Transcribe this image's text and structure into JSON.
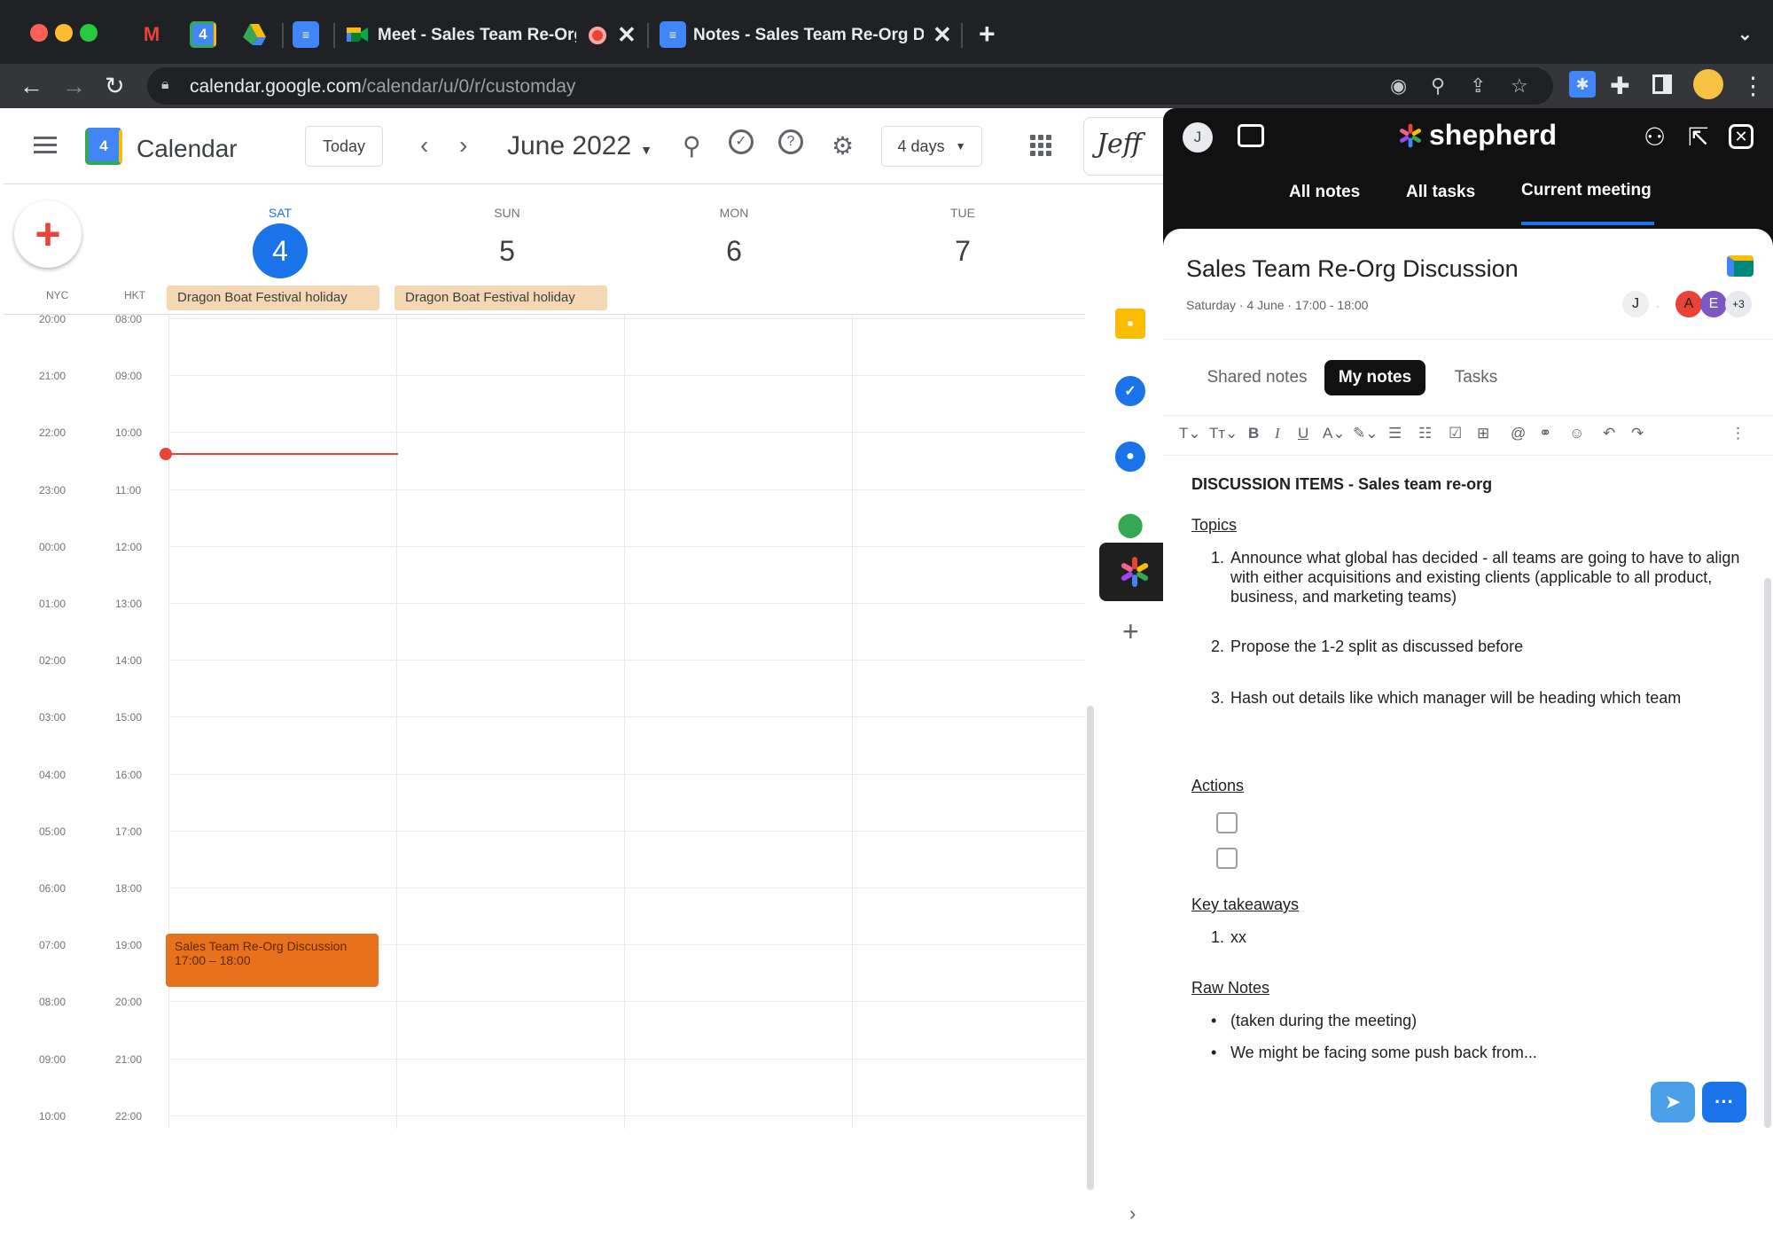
{
  "browser": {
    "colors": {
      "close": "#ff5f57",
      "minimize": "#febc2e",
      "maximize": "#28c840"
    },
    "tabs": [
      {
        "icon": "gmail-icon"
      },
      {
        "icon": "google-calendar-icon",
        "badge": "4"
      },
      {
        "icon": "google-drive-icon"
      },
      {
        "icon": "google-docs-icon"
      },
      {
        "icon": "google-meet-icon",
        "title": "Meet - Sales Team Re-Org"
      },
      {
        "icon": "google-docs-icon",
        "title": "Notes - Sales Team Re-Org Dis"
      }
    ],
    "close_glyph": "✕",
    "new_tab": "+",
    "url_domain": "calendar.google.com",
    "url_path": "/calendar/u/0/r/customday"
  },
  "calendar": {
    "logo_badge": "4",
    "app_name": "Calendar",
    "today_label": "Today",
    "month_label": "June 2022",
    "view_label": "4 days",
    "signature": "Jeff",
    "timezones": [
      "NYC",
      "HKT"
    ],
    "days": [
      {
        "dow": "SAT",
        "date": "4",
        "today": true
      },
      {
        "dow": "SUN",
        "date": "5"
      },
      {
        "dow": "MON",
        "date": "6"
      },
      {
        "dow": "TUE",
        "date": "7"
      }
    ],
    "allday_events": [
      "Dragon Boat Festival holiday",
      "Dragon Boat Festival holiday"
    ],
    "time_rows": [
      [
        "20:00",
        "08:00"
      ],
      [
        "21:00",
        "09:00"
      ],
      [
        "22:00",
        "10:00"
      ],
      [
        "23:00",
        "11:00"
      ],
      [
        "00:00",
        "12:00"
      ],
      [
        "01:00",
        "13:00"
      ],
      [
        "02:00",
        "14:00"
      ],
      [
        "03:00",
        "15:00"
      ],
      [
        "04:00",
        "16:00"
      ],
      [
        "05:00",
        "17:00"
      ],
      [
        "06:00",
        "18:00"
      ],
      [
        "07:00",
        "19:00"
      ],
      [
        "08:00",
        "20:00"
      ],
      [
        "09:00",
        "21:00"
      ],
      [
        "10:00",
        "22:00"
      ]
    ],
    "event": {
      "title": "Sales Team Re-Org Discussion",
      "time": "17:00 – 18:00",
      "color": "#e8711c"
    }
  },
  "shepherd": {
    "avatar": "J",
    "brand": "shepherd",
    "tabs": [
      "All notes",
      "All tasks",
      "Current meeting"
    ],
    "active_tab": "Current meeting",
    "meeting": {
      "title": "Sales Team Re-Org Discussion",
      "meta": "Saturday · 4 June · 17:00 - 18:00",
      "attendees": [
        "J",
        "A",
        "E",
        "+3"
      ]
    },
    "note_tabs": [
      "Shared notes",
      "My notes",
      "Tasks"
    ],
    "active_note_tab": "My notes",
    "notes": {
      "title": "DISCUSSION ITEMS - Sales team re-org",
      "topics_heading": "Topics",
      "topics": [
        "Announce what global has decided - all teams are going to have to align with either acquisitions and existing clients (applicable to all product, business, and marketing teams)",
        "Propose the 1-2 split as discussed before",
        "Hash out details like which manager will be heading which team"
      ],
      "actions_heading": "Actions",
      "takeaways_heading": "Key takeaways",
      "takeaways": [
        "xx"
      ],
      "raw_heading": "Raw Notes",
      "raw": [
        "(taken during the meeting)",
        "We might be facing some push back from..."
      ]
    },
    "colors": {
      "accent": "#1a73e8"
    }
  }
}
